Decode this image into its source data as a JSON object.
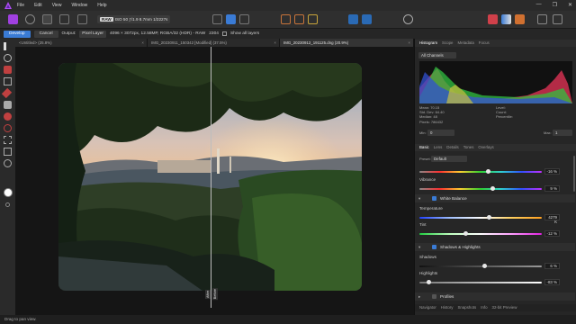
{
  "menu": {
    "items": [
      "File",
      "Edit",
      "View",
      "Window",
      "Help"
    ]
  },
  "toolbar": {
    "raw_badge": "RAW",
    "camera_info": "ISO 50 ƒ/1.9 8.7mm 1/2227s"
  },
  "context": {
    "develop_label": "Develop",
    "cancel_label": "Cancel",
    "output_label": "Output:",
    "output_value": "Pixel Layer",
    "image_info": "4096 × 3072px, 12.58MP, RGBA/32 (HDR) - RAW",
    "extra_info": "2304",
    "show_all_layers": "Show all layers"
  },
  "tabs": [
    {
      "label": "<Untitled> (25.8%)"
    },
    {
      "label": "IMG_20230911_150342 [Modified] (37.5%)"
    },
    {
      "label": "IMG_20230912_191125.dng (20.9%)"
    }
  ],
  "split": {
    "left_label": "After",
    "right_label": "Before"
  },
  "panel": {
    "top_tabs": [
      "Histogram",
      "Scope",
      "Metadata",
      "Focus"
    ],
    "channel_select": "All Channels",
    "stats_left": [
      "Mean: 70.15",
      "Std. Dev: 64.40",
      "Median: 48",
      "Pixels: 786432"
    ],
    "stats_right": [
      "Level:",
      "Count:",
      "Percentile:"
    ],
    "min_label": "Min:",
    "min_value": "0",
    "max_label": "Max:",
    "max_value": "1",
    "dev_tabs": [
      "Basic",
      "Lens",
      "Details",
      "Tones",
      "Overlays"
    ],
    "preset_label": "Preset:",
    "preset_value": "Default",
    "sliders": [
      {
        "label": "",
        "value": "-16 %",
        "pct": 0.56
      },
      {
        "label": "Vibrance",
        "value": "9 %",
        "pct": 0.6
      },
      {
        "label": "Temperature",
        "value": "4279 K",
        "pct": 0.57
      },
      {
        "label": "Tint",
        "value": "-12 %",
        "pct": 0.38
      },
      {
        "label": "Shadows",
        "value": "6 %",
        "pct": 0.53
      },
      {
        "label": "Highlights",
        "value": "-83 %",
        "pct": 0.08
      }
    ],
    "section_wb": "White Balance",
    "section_sh": "Shadows & Highlights",
    "section_profiles": "Profiles",
    "bottom_tabs": [
      "Navigator",
      "History",
      "Snapshots",
      "Info",
      "32-bit Preview"
    ]
  },
  "status": {
    "hint": "Drag to pan view."
  },
  "colors": {
    "accent": "#3a7bd5",
    "affinity_logo": "#c24cf4"
  }
}
